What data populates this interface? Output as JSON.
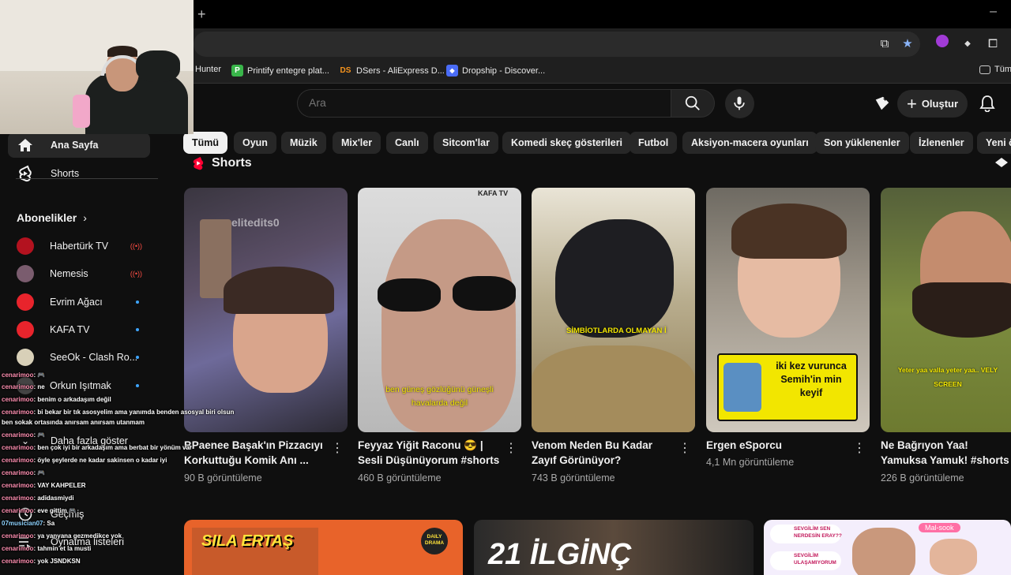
{
  "browser": {
    "new_tab": "+",
    "window_min": "–",
    "bookmarks": [
      {
        "label": "Hunter",
        "icon": ""
      },
      {
        "label": "Printify entegre plat...",
        "icon": "P",
        "color": "#39b54a"
      },
      {
        "label": "DSers - AliExpress D...",
        "icon": "DS",
        "color": "#f7941d"
      },
      {
        "label": "Dropship - Discover...",
        "icon": "◆",
        "color": "#4a6cf7"
      }
    ],
    "bookmark_folder": "Tüm"
  },
  "header": {
    "search_placeholder": "Ara",
    "create_label": "Oluştur"
  },
  "chips": [
    "Tümü",
    "Oyun",
    "Müzik",
    "Mix'ler",
    "Canlı",
    "Sitcom'lar",
    "Komedi skeç gösterileri",
    "Futbol",
    "Aksiyon-macera oyunları",
    "Son yüklenenler",
    "İzlenenler",
    "Yeni ö"
  ],
  "sidebar": {
    "home": "Ana Sayfa",
    "shorts": "Shorts",
    "subscriptions_title": "Abonelikler",
    "channels": [
      {
        "name": "Habertürk TV",
        "badge": "live",
        "color": "#b3121f"
      },
      {
        "name": "Nemesis",
        "badge": "live",
        "color": "#7a5c6e"
      },
      {
        "name": "Evrim Ağacı",
        "badge": "new",
        "color": "#e8242c"
      },
      {
        "name": "KAFA TV",
        "badge": "new",
        "color": "#e8242c"
      },
      {
        "name": "SeeOk - Clash Ro...",
        "badge": "new",
        "color": "#d8d0b8"
      },
      {
        "name": "Orkun Işıtmak",
        "badge": "new",
        "color": "#444"
      }
    ],
    "show_more": "Daha fazla göster",
    "history": "Geçmiş",
    "playlists": "Oynatma listeleri"
  },
  "shorts": {
    "title": "Shorts",
    "items": [
      {
        "title": "BPaenee Başak'ın Pizzacıyı Korkuttuğu Komik Anı ...",
        "views": "90 B görüntüleme",
        "overlay": "elitedits0",
        "caption": ""
      },
      {
        "title": "Feyyaz Yiğit Raconu 😎 | Sesli Düşünüyorum #shorts",
        "views": "460 B görüntüleme",
        "overlay": "KAFA TV",
        "caption": "ben güneş gözlüğünü güneşli havalarda değil"
      },
      {
        "title": "Venom Neden Bu Kadar Zayıf Görünüyor?",
        "views": "743 B görüntüleme",
        "overlay": "",
        "caption": "SİMBİOTLARDA OLMAYAN İ"
      },
      {
        "title": "Ergen eSporcu",
        "views": "4,1 Mn görüntüleme",
        "overlay": "",
        "caption": "iki kez vurunca Semih'in min keyif"
      },
      {
        "title": "Ne Bağrıyon Yaa! Yamuksa Yamuk! #shorts",
        "views": "226 B görüntüleme",
        "overlay": "",
        "caption": "Yeter yaa valla yeter yaa.. VELY SCREEN"
      }
    ]
  },
  "bottom_row": [
    {
      "text": "SILA ERTAŞ",
      "badge": "DAILY DRAMA"
    },
    {
      "text": "21 İLGİNÇ"
    },
    {
      "text": "SEVGİLİM SEN NERDESİN ERAY??",
      "text2": "SEVGİLİM ULAŞAMIYORUM",
      "tag": "Mal-sook"
    }
  ],
  "chat": [
    {
      "user": "cenarimoo",
      "msg": ": 🎮"
    },
    {
      "user": "cenarimoo",
      "msg": ": ne"
    },
    {
      "user": "cenarimoo",
      "msg": ": benim o arkadaşım değil"
    },
    {
      "user": "cenarimoo",
      "msg": ": bi bekar bir tık asosyelim ama yanımda benden asosyal biri olsun"
    },
    {
      "user": "",
      "msg": "ben sokak ortasında anırsam anırsam utanmam"
    },
    {
      "user": "cenarimoo",
      "msg": ": 🎮"
    },
    {
      "user": "cenarimoo",
      "msg": ": ben çok iyi bir arkadaşım ama berbat bir yönüm var"
    },
    {
      "user": "cenarimoo",
      "msg": ": öyle şeylerde ne kadar sakinsen o kadar iyi"
    },
    {
      "user": "cenarimoo",
      "msg": ": 🎮"
    },
    {
      "user": "cenarimoo",
      "msg": ": VAY KAHPELER"
    },
    {
      "user": "cenarimoo",
      "msg": ": adidasmiydi"
    },
    {
      "user": "cenarimoo",
      "msg": ": eve gittim 🎮"
    },
    {
      "user": "07musician07",
      "msg": ": Sa"
    },
    {
      "user": "cenarimoo",
      "msg": ": ya yanyana gezmedikce yok"
    },
    {
      "user": "cenarimoo",
      "msg": ": tahmin et la musti"
    },
    {
      "user": "cenarimoo",
      "msg": ": yok JSNDKSN"
    }
  ]
}
